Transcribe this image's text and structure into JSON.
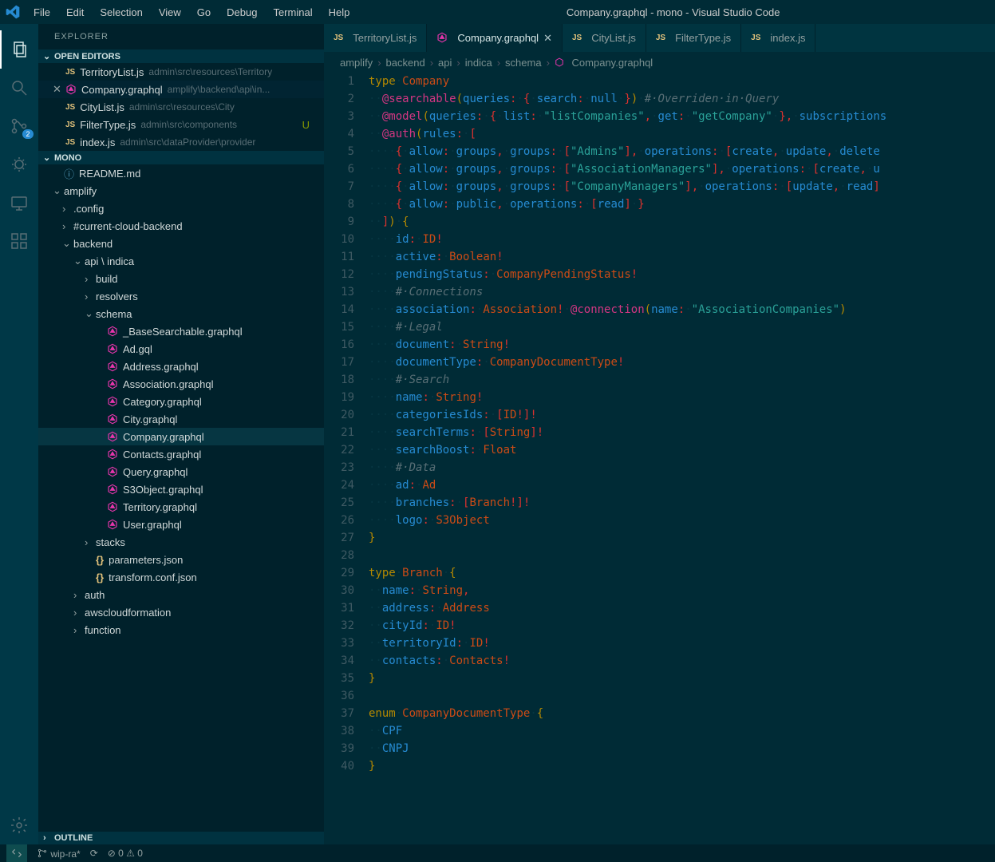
{
  "window": {
    "title": "Company.graphql - mono - Visual Studio Code"
  },
  "menu": [
    "File",
    "Edit",
    "Selection",
    "View",
    "Go",
    "Debug",
    "Terminal",
    "Help"
  ],
  "activity": {
    "scm_badge": "2"
  },
  "sidebar": {
    "title": "Explorer",
    "sections": {
      "open_editors": "Open Editors",
      "workspace": "mono",
      "outline": "Outline"
    },
    "open_editors": [
      {
        "icon": "js",
        "name": "TerritoryList.js",
        "hint": "admin\\src\\resources\\Territory",
        "active": false
      },
      {
        "icon": "gql",
        "name": "Company.graphql",
        "hint": "amplify\\backend\\api\\in...",
        "active": true
      },
      {
        "icon": "js",
        "name": "CityList.js",
        "hint": "admin\\src\\resources\\City",
        "active": false
      },
      {
        "icon": "js",
        "name": "FilterType.js",
        "hint": "admin\\src\\components",
        "status": "U",
        "active": false
      },
      {
        "icon": "js",
        "name": "index.js",
        "hint": "admin\\src\\dataProvider\\provider",
        "active": false
      }
    ],
    "tree": [
      {
        "d": 0,
        "kind": "file",
        "icon": "info",
        "name": "README.md"
      },
      {
        "d": 0,
        "kind": "folder",
        "open": true,
        "name": "amplify"
      },
      {
        "d": 1,
        "kind": "folder",
        "open": false,
        "name": ".config"
      },
      {
        "d": 1,
        "kind": "folder",
        "open": false,
        "name": "#current-cloud-backend"
      },
      {
        "d": 1,
        "kind": "folder",
        "open": true,
        "name": "backend"
      },
      {
        "d": 2,
        "kind": "folder",
        "open": true,
        "name": "api \\ indica"
      },
      {
        "d": 3,
        "kind": "folder",
        "open": false,
        "name": "build"
      },
      {
        "d": 3,
        "kind": "folder",
        "open": false,
        "name": "resolvers"
      },
      {
        "d": 3,
        "kind": "folder",
        "open": true,
        "name": "schema"
      },
      {
        "d": 4,
        "kind": "file",
        "icon": "gql",
        "name": "_BaseSearchable.graphql"
      },
      {
        "d": 4,
        "kind": "file",
        "icon": "gql",
        "name": "Ad.gql"
      },
      {
        "d": 4,
        "kind": "file",
        "icon": "gql",
        "name": "Address.graphql"
      },
      {
        "d": 4,
        "kind": "file",
        "icon": "gql",
        "name": "Association.graphql"
      },
      {
        "d": 4,
        "kind": "file",
        "icon": "gql",
        "name": "Category.graphql"
      },
      {
        "d": 4,
        "kind": "file",
        "icon": "gql",
        "name": "City.graphql"
      },
      {
        "d": 4,
        "kind": "file",
        "icon": "gql",
        "name": "Company.graphql",
        "selected": true
      },
      {
        "d": 4,
        "kind": "file",
        "icon": "gql",
        "name": "Contacts.graphql"
      },
      {
        "d": 4,
        "kind": "file",
        "icon": "gql",
        "name": "Query.graphql"
      },
      {
        "d": 4,
        "kind": "file",
        "icon": "gql",
        "name": "S3Object.graphql"
      },
      {
        "d": 4,
        "kind": "file",
        "icon": "gql",
        "name": "Territory.graphql"
      },
      {
        "d": 4,
        "kind": "file",
        "icon": "gql",
        "name": "User.graphql"
      },
      {
        "d": 3,
        "kind": "folder",
        "open": false,
        "name": "stacks"
      },
      {
        "d": 3,
        "kind": "file",
        "icon": "json",
        "name": "parameters.json"
      },
      {
        "d": 3,
        "kind": "file",
        "icon": "json",
        "name": "transform.conf.json"
      },
      {
        "d": 2,
        "kind": "folder",
        "open": false,
        "name": "auth"
      },
      {
        "d": 2,
        "kind": "folder",
        "open": false,
        "name": "awscloudformation"
      },
      {
        "d": 2,
        "kind": "folder",
        "open": false,
        "name": "function"
      }
    ]
  },
  "tabs": [
    {
      "icon": "js",
      "label": "TerritoryList.js"
    },
    {
      "icon": "gql",
      "label": "Company.graphql",
      "active": true
    },
    {
      "icon": "js",
      "label": "CityList.js"
    },
    {
      "icon": "js",
      "label": "FilterType.js"
    },
    {
      "icon": "js",
      "label": "index.js"
    }
  ],
  "breadcrumb": [
    "amplify",
    "backend",
    "api",
    "indica",
    "schema",
    "Company.graphql"
  ],
  "code": [
    [
      [
        "kw",
        "type"
      ],
      [
        "ws",
        "·"
      ],
      [
        "type",
        "Company"
      ]
    ],
    [
      [
        "ws",
        "··"
      ],
      [
        "dir",
        "@searchable"
      ],
      [
        "brace",
        "("
      ],
      [
        "field",
        "queries"
      ],
      [
        "punc",
        ":"
      ],
      [
        "ws",
        "·"
      ],
      [
        "punc",
        "{"
      ],
      [
        "ws",
        "·"
      ],
      [
        "field",
        "search"
      ],
      [
        "punc",
        ":"
      ],
      [
        "ws",
        "·"
      ],
      [
        "ent",
        "null"
      ],
      [
        "ws",
        "·"
      ],
      [
        "punc",
        "}"
      ],
      [
        "brace",
        ")"
      ],
      [
        "ws",
        "·"
      ],
      [
        "comment",
        "#·Overriden·in·Query"
      ]
    ],
    [
      [
        "ws",
        "··"
      ],
      [
        "dir",
        "@model"
      ],
      [
        "brace",
        "("
      ],
      [
        "field",
        "queries"
      ],
      [
        "punc",
        ":"
      ],
      [
        "ws",
        "·"
      ],
      [
        "punc",
        "{"
      ],
      [
        "ws",
        "·"
      ],
      [
        "field",
        "list"
      ],
      [
        "punc",
        ":"
      ],
      [
        "ws",
        "·"
      ],
      [
        "str",
        "\"listCompanies\""
      ],
      [
        "punc",
        ","
      ],
      [
        "ws",
        "·"
      ],
      [
        "field",
        "get"
      ],
      [
        "punc",
        ":"
      ],
      [
        "ws",
        "·"
      ],
      [
        "str",
        "\"getCompany\""
      ],
      [
        "ws",
        "·"
      ],
      [
        "punc",
        "}"
      ],
      [
        "punc",
        ","
      ],
      [
        "ws",
        "·"
      ],
      [
        "field",
        "subscriptions"
      ]
    ],
    [
      [
        "ws",
        "··"
      ],
      [
        "dir",
        "@auth"
      ],
      [
        "brace",
        "("
      ],
      [
        "field",
        "rules"
      ],
      [
        "punc",
        ":"
      ],
      [
        "ws",
        "·"
      ],
      [
        "punc",
        "["
      ]
    ],
    [
      [
        "ws",
        "····"
      ],
      [
        "punc",
        "{"
      ],
      [
        "ws",
        "·"
      ],
      [
        "field",
        "allow"
      ],
      [
        "punc",
        ":"
      ],
      [
        "ws",
        "·"
      ],
      [
        "ent",
        "groups"
      ],
      [
        "punc",
        ","
      ],
      [
        "ws",
        "·"
      ],
      [
        "field",
        "groups"
      ],
      [
        "punc",
        ":"
      ],
      [
        "ws",
        "·"
      ],
      [
        "punc",
        "["
      ],
      [
        "str",
        "\"Admins\""
      ],
      [
        "punc",
        "]"
      ],
      [
        "punc",
        ","
      ],
      [
        "ws",
        "·"
      ],
      [
        "field",
        "operations"
      ],
      [
        "punc",
        ":"
      ],
      [
        "ws",
        "·"
      ],
      [
        "punc",
        "["
      ],
      [
        "ent",
        "create"
      ],
      [
        "punc",
        ","
      ],
      [
        "ws",
        "·"
      ],
      [
        "ent",
        "update"
      ],
      [
        "punc",
        ","
      ],
      [
        "ws",
        "·"
      ],
      [
        "ent",
        "delete"
      ]
    ],
    [
      [
        "ws",
        "····"
      ],
      [
        "punc",
        "{"
      ],
      [
        "ws",
        "·"
      ],
      [
        "field",
        "allow"
      ],
      [
        "punc",
        ":"
      ],
      [
        "ws",
        "·"
      ],
      [
        "ent",
        "groups"
      ],
      [
        "punc",
        ","
      ],
      [
        "ws",
        "·"
      ],
      [
        "field",
        "groups"
      ],
      [
        "punc",
        ":"
      ],
      [
        "ws",
        "·"
      ],
      [
        "punc",
        "["
      ],
      [
        "str",
        "\"AssociationManagers\""
      ],
      [
        "punc",
        "]"
      ],
      [
        "punc",
        ","
      ],
      [
        "ws",
        "·"
      ],
      [
        "field",
        "operations"
      ],
      [
        "punc",
        ":"
      ],
      [
        "ws",
        "·"
      ],
      [
        "punc",
        "["
      ],
      [
        "ent",
        "create"
      ],
      [
        "punc",
        ","
      ],
      [
        "ws",
        "·"
      ],
      [
        "ent",
        "u"
      ]
    ],
    [
      [
        "ws",
        "····"
      ],
      [
        "punc",
        "{"
      ],
      [
        "ws",
        "·"
      ],
      [
        "field",
        "allow"
      ],
      [
        "punc",
        ":"
      ],
      [
        "ws",
        "·"
      ],
      [
        "ent",
        "groups"
      ],
      [
        "punc",
        ","
      ],
      [
        "ws",
        "·"
      ],
      [
        "field",
        "groups"
      ],
      [
        "punc",
        ":"
      ],
      [
        "ws",
        "·"
      ],
      [
        "punc",
        "["
      ],
      [
        "str",
        "\"CompanyManagers\""
      ],
      [
        "punc",
        "]"
      ],
      [
        "punc",
        ","
      ],
      [
        "ws",
        "·"
      ],
      [
        "field",
        "operations"
      ],
      [
        "punc",
        ":"
      ],
      [
        "ws",
        "·"
      ],
      [
        "punc",
        "["
      ],
      [
        "ent",
        "update"
      ],
      [
        "punc",
        ","
      ],
      [
        "ws",
        "·"
      ],
      [
        "ent",
        "read"
      ],
      [
        "punc",
        "]"
      ]
    ],
    [
      [
        "ws",
        "····"
      ],
      [
        "punc",
        "{"
      ],
      [
        "ws",
        "·"
      ],
      [
        "field",
        "allow"
      ],
      [
        "punc",
        ":"
      ],
      [
        "ws",
        "·"
      ],
      [
        "ent",
        "public"
      ],
      [
        "punc",
        ","
      ],
      [
        "ws",
        "·"
      ],
      [
        "field",
        "operations"
      ],
      [
        "punc",
        ":"
      ],
      [
        "ws",
        "·"
      ],
      [
        "punc",
        "["
      ],
      [
        "ent",
        "read"
      ],
      [
        "punc",
        "]"
      ],
      [
        "ws",
        "·"
      ],
      [
        "punc",
        "}"
      ]
    ],
    [
      [
        "ws",
        "··"
      ],
      [
        "punc",
        "]"
      ],
      [
        "brace",
        ")"
      ],
      [
        "ws",
        "·"
      ],
      [
        "brace",
        "{"
      ]
    ],
    [
      [
        "ws",
        "····"
      ],
      [
        "field",
        "id"
      ],
      [
        "punc",
        ":"
      ],
      [
        "ws",
        "·"
      ],
      [
        "type",
        "ID"
      ],
      [
        "punc",
        "!"
      ]
    ],
    [
      [
        "ws",
        "····"
      ],
      [
        "field",
        "active"
      ],
      [
        "punc",
        ":"
      ],
      [
        "ws",
        "·"
      ],
      [
        "type",
        "Boolean"
      ],
      [
        "punc",
        "!"
      ]
    ],
    [
      [
        "ws",
        "····"
      ],
      [
        "field",
        "pendingStatus"
      ],
      [
        "punc",
        ":"
      ],
      [
        "ws",
        "·"
      ],
      [
        "type",
        "CompanyPendingStatus"
      ],
      [
        "punc",
        "!"
      ]
    ],
    [
      [
        "ws",
        "····"
      ],
      [
        "comment",
        "#·Connections"
      ]
    ],
    [
      [
        "ws",
        "····"
      ],
      [
        "field",
        "association"
      ],
      [
        "punc",
        ":"
      ],
      [
        "ws",
        "·"
      ],
      [
        "type",
        "Association"
      ],
      [
        "punc",
        "!"
      ],
      [
        "ws",
        "·"
      ],
      [
        "dir",
        "@connection"
      ],
      [
        "brace",
        "("
      ],
      [
        "field",
        "name"
      ],
      [
        "punc",
        ":"
      ],
      [
        "ws",
        "·"
      ],
      [
        "str",
        "\"AssociationCompanies\""
      ],
      [
        "brace",
        ")"
      ]
    ],
    [
      [
        "ws",
        "····"
      ],
      [
        "comment",
        "#·Legal"
      ]
    ],
    [
      [
        "ws",
        "····"
      ],
      [
        "field",
        "document"
      ],
      [
        "punc",
        ":"
      ],
      [
        "ws",
        "·"
      ],
      [
        "type",
        "String"
      ],
      [
        "punc",
        "!"
      ]
    ],
    [
      [
        "ws",
        "····"
      ],
      [
        "field",
        "documentType"
      ],
      [
        "punc",
        ":"
      ],
      [
        "ws",
        "·"
      ],
      [
        "type",
        "CompanyDocumentType"
      ],
      [
        "punc",
        "!"
      ]
    ],
    [
      [
        "ws",
        "····"
      ],
      [
        "comment",
        "#·Search"
      ]
    ],
    [
      [
        "ws",
        "····"
      ],
      [
        "field",
        "name"
      ],
      [
        "punc",
        ":"
      ],
      [
        "ws",
        "·"
      ],
      [
        "type",
        "String"
      ],
      [
        "punc",
        "!"
      ]
    ],
    [
      [
        "ws",
        "····"
      ],
      [
        "field",
        "categoriesIds"
      ],
      [
        "punc",
        ":"
      ],
      [
        "ws",
        "·"
      ],
      [
        "punc",
        "["
      ],
      [
        "type",
        "ID"
      ],
      [
        "punc",
        "!"
      ],
      [
        "punc",
        "]"
      ],
      [
        "punc",
        "!"
      ]
    ],
    [
      [
        "ws",
        "····"
      ],
      [
        "field",
        "searchTerms"
      ],
      [
        "punc",
        ":"
      ],
      [
        "ws",
        "·"
      ],
      [
        "punc",
        "["
      ],
      [
        "type",
        "String"
      ],
      [
        "punc",
        "]"
      ],
      [
        "punc",
        "!"
      ]
    ],
    [
      [
        "ws",
        "····"
      ],
      [
        "field",
        "searchBoost"
      ],
      [
        "punc",
        ":"
      ],
      [
        "ws",
        "·"
      ],
      [
        "type",
        "Float"
      ]
    ],
    [
      [
        "ws",
        "····"
      ],
      [
        "comment",
        "#·Data"
      ]
    ],
    [
      [
        "ws",
        "····"
      ],
      [
        "field",
        "ad"
      ],
      [
        "punc",
        ":"
      ],
      [
        "ws",
        "·"
      ],
      [
        "type",
        "Ad"
      ]
    ],
    [
      [
        "ws",
        "····"
      ],
      [
        "field",
        "branches"
      ],
      [
        "punc",
        ":"
      ],
      [
        "ws",
        "·"
      ],
      [
        "punc",
        "["
      ],
      [
        "type",
        "Branch"
      ],
      [
        "punc",
        "!"
      ],
      [
        "punc",
        "]"
      ],
      [
        "punc",
        "!"
      ]
    ],
    [
      [
        "ws",
        "····"
      ],
      [
        "field",
        "logo"
      ],
      [
        "punc",
        ":"
      ],
      [
        "ws",
        "·"
      ],
      [
        "type",
        "S3Object"
      ]
    ],
    [
      [
        "brace",
        "}"
      ]
    ],
    [],
    [
      [
        "kw",
        "type"
      ],
      [
        "ws",
        "·"
      ],
      [
        "type",
        "Branch"
      ],
      [
        "ws",
        "·"
      ],
      [
        "brace",
        "{"
      ]
    ],
    [
      [
        "ws",
        "··"
      ],
      [
        "field",
        "name"
      ],
      [
        "punc",
        ":"
      ],
      [
        "ws",
        "·"
      ],
      [
        "type",
        "String"
      ],
      [
        "punc",
        ","
      ]
    ],
    [
      [
        "ws",
        "··"
      ],
      [
        "field",
        "address"
      ],
      [
        "punc",
        ":"
      ],
      [
        "ws",
        "·"
      ],
      [
        "type",
        "Address"
      ]
    ],
    [
      [
        "ws",
        "··"
      ],
      [
        "field",
        "cityId"
      ],
      [
        "punc",
        ":"
      ],
      [
        "ws",
        "·"
      ],
      [
        "type",
        "ID"
      ],
      [
        "punc",
        "!"
      ]
    ],
    [
      [
        "ws",
        "··"
      ],
      [
        "field",
        "territoryId"
      ],
      [
        "punc",
        ":"
      ],
      [
        "ws",
        "·"
      ],
      [
        "type",
        "ID"
      ],
      [
        "punc",
        "!"
      ]
    ],
    [
      [
        "ws",
        "··"
      ],
      [
        "field",
        "contacts"
      ],
      [
        "punc",
        ":"
      ],
      [
        "ws",
        "·"
      ],
      [
        "type",
        "Contacts"
      ],
      [
        "punc",
        "!"
      ]
    ],
    [
      [
        "brace",
        "}"
      ]
    ],
    [],
    [
      [
        "kw",
        "enum"
      ],
      [
        "ws",
        "·"
      ],
      [
        "type",
        "CompanyDocumentType"
      ],
      [
        "ws",
        "·"
      ],
      [
        "brace",
        "{"
      ]
    ],
    [
      [
        "ws",
        "··"
      ],
      [
        "ent",
        "CPF"
      ]
    ],
    [
      [
        "ws",
        "··"
      ],
      [
        "ent",
        "CNPJ"
      ]
    ],
    [
      [
        "brace",
        "}"
      ]
    ]
  ],
  "statusbar": {
    "branch": "wip-ra*",
    "sync": "⟳",
    "errors": "0",
    "warnings": "0"
  }
}
